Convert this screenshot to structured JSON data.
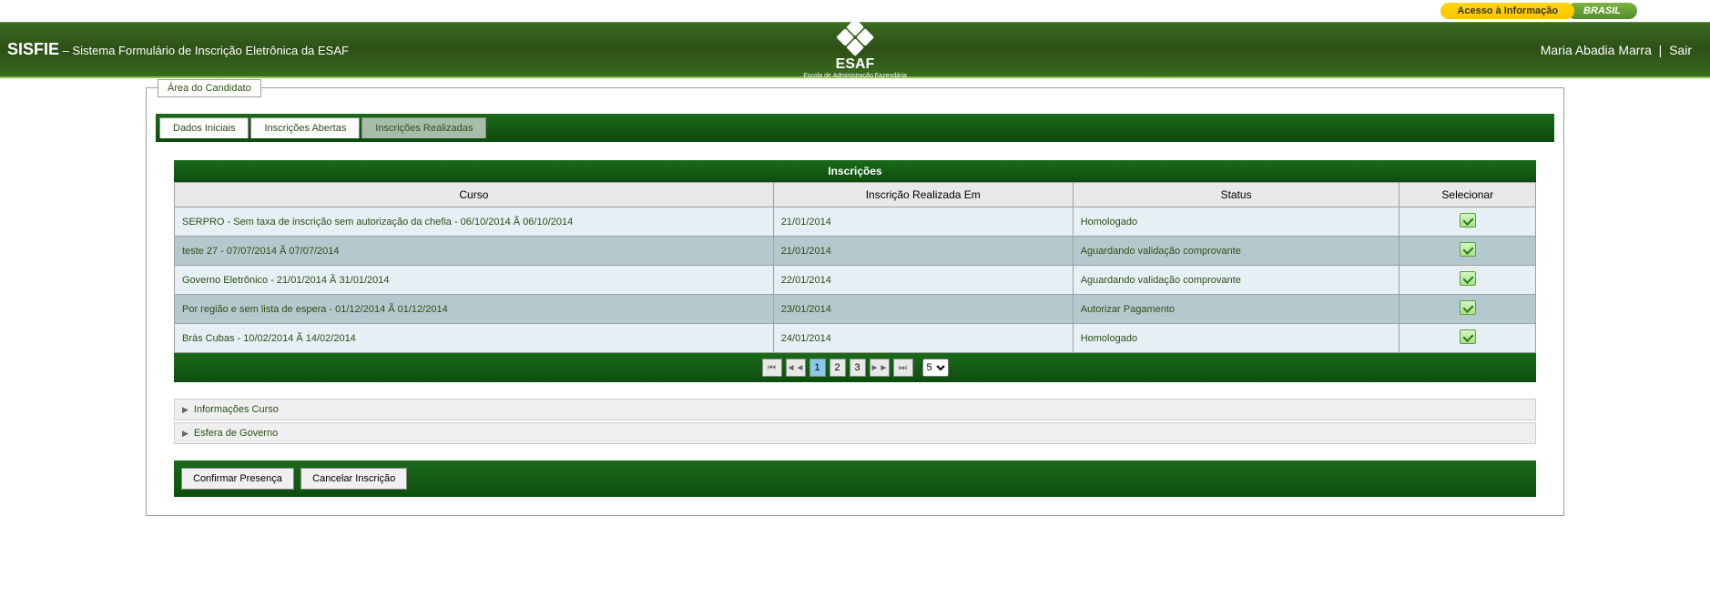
{
  "gov_bar": {
    "access_label": "Acesso à Informação",
    "brasil_label": "BRASIL"
  },
  "header": {
    "title_main": "SISFIE",
    "title_sub": " – Sistema Formulário de Inscrição Eletrônica da ESAF",
    "logo_text": "ESAF",
    "logo_sub": "Escola de Administração Fazendária",
    "user_name": "Maria Abadia Marra",
    "logout_label": "Sair"
  },
  "fieldset_legend": "Área do Candidato",
  "tabs": {
    "t0": "Dados Iniciais",
    "t1": "Inscrições Abertas",
    "t2": "Inscrições Realizadas"
  },
  "table": {
    "title": "Inscrições",
    "headers": {
      "curso": "Curso",
      "realizada": "Inscrição Realizada Em",
      "status": "Status",
      "selecionar": "Selecionar"
    },
    "rows": [
      {
        "curso": "SERPRO - Sem taxa de inscrição sem autorização da chefia - 06/10/2014 Ã  06/10/2014",
        "realizada": "21/01/2014",
        "status": "Homologado"
      },
      {
        "curso": "teste 27 - 07/07/2014 Ã  07/07/2014",
        "realizada": "21/01/2014",
        "status": "Aguardando validação comprovante"
      },
      {
        "curso": "Governo Eletrônico - 21/01/2014 Ã  31/01/2014",
        "realizada": "22/01/2014",
        "status": "Aguardando validação comprovante"
      },
      {
        "curso": "Por região e sem lista de espera - 01/12/2014 Ã  01/12/2014",
        "realizada": "23/01/2014",
        "status": "Autorizar Pagamento"
      },
      {
        "curso": "Brás Cubas - 10/02/2014 Ã  14/02/2014",
        "realizada": "24/01/2014",
        "status": "Homologado"
      }
    ]
  },
  "paginator": {
    "pages": {
      "p1": "1",
      "p2": "2",
      "p3": "3"
    },
    "page_size": "5"
  },
  "accordion": {
    "a0": "Informações Curso",
    "a1": "Esfera de Governo"
  },
  "actions": {
    "confirmar": "Confirmar Presença",
    "cancelar": "Cancelar Inscrição"
  }
}
